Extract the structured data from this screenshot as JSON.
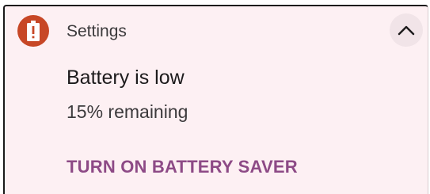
{
  "notification": {
    "app_name": "Settings",
    "title": "Battery is low",
    "text": "15% remaining",
    "action_label": "TURN ON BATTERY SAVER",
    "icon": "battery-alert-icon",
    "expand_icon": "chevron-up-icon"
  },
  "colors": {
    "background": "#fdf0f3",
    "icon_badge": "#c74726",
    "action": "#8d4a86",
    "expand_button": "#f1e4e8"
  }
}
